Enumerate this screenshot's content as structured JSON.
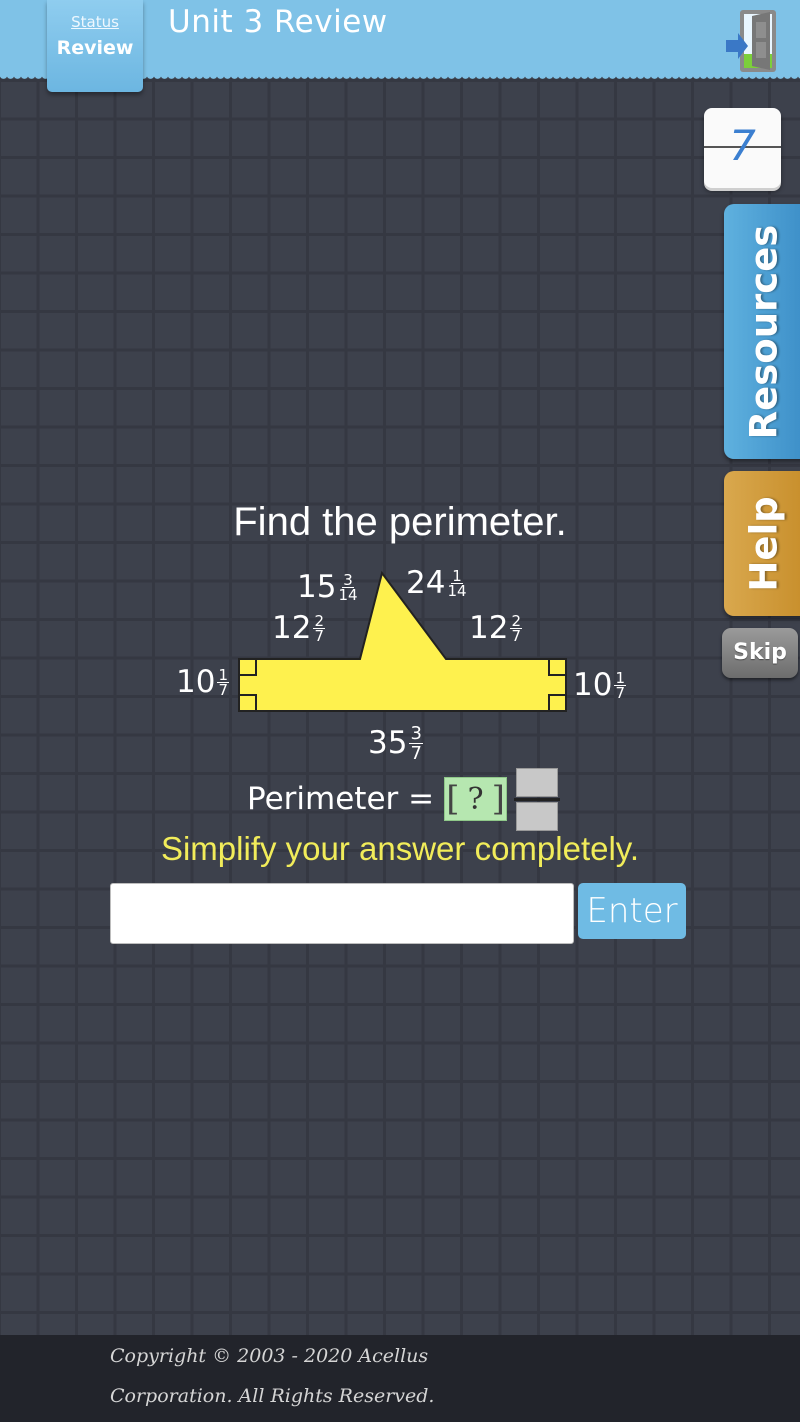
{
  "header": {
    "status_link": "Status",
    "status_value": "Review",
    "title": "Unit 3 Review",
    "exit_icon": "exit-door-icon"
  },
  "rail": {
    "counter": "7",
    "resources_label": "Resources",
    "help_label": "Help",
    "skip_label": "Skip"
  },
  "question": {
    "title": "Find the perimeter.",
    "shape_color": "#fef14e",
    "side_labels": [
      {
        "id": "left-slant",
        "whole": "15",
        "num": "3",
        "den": "14"
      },
      {
        "id": "right-slant",
        "whole": "24",
        "num": "1",
        "den": "14"
      },
      {
        "id": "top-left",
        "whole": "12",
        "num": "2",
        "den": "7"
      },
      {
        "id": "top-right",
        "whole": "12",
        "num": "2",
        "den": "7"
      },
      {
        "id": "left-side",
        "whole": "10",
        "num": "1",
        "den": "7"
      },
      {
        "id": "right-side",
        "whole": "10",
        "num": "1",
        "den": "7"
      },
      {
        "id": "bottom",
        "whole": "35",
        "num": "3",
        "den": "7"
      }
    ],
    "perimeter_label": "Perimeter =",
    "answer_placeholder": "?",
    "hint": "Simplify your answer completely."
  },
  "answer": {
    "input_value": "",
    "enter_label": "Enter"
  },
  "footer": {
    "line1": "Copyright © 2003 - 2020 Acellus",
    "line2": "Corporation.  All Rights Reserved."
  }
}
